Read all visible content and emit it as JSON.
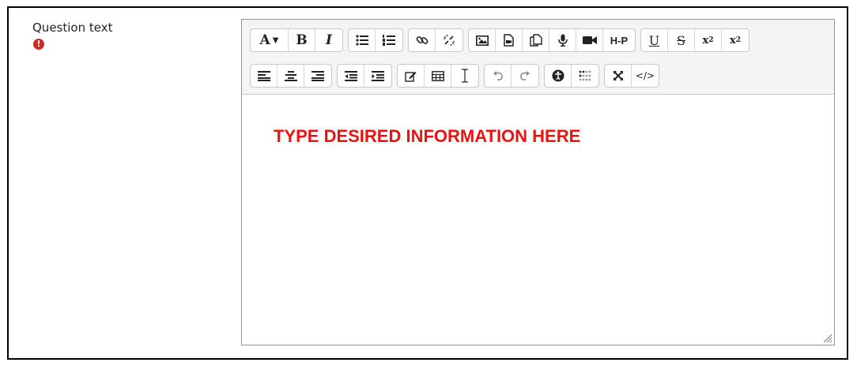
{
  "field": {
    "label": "Question text",
    "required_icon": "exclamation-circle-icon"
  },
  "toolbar": {
    "font_button": "A",
    "bold": "B",
    "italic": "I",
    "h5p": "H-P",
    "underline": "U",
    "strike": "S",
    "subscript_base": "x",
    "subscript_mark": "2",
    "superscript_base": "x",
    "superscript_mark": "2",
    "html": "</>"
  },
  "editor": {
    "content": "TYPE DESIRED INFORMATION HERE"
  },
  "colors": {
    "content_text": "#ee1111",
    "required": "#ca3120",
    "toolbar_bg": "#f4f4f4"
  }
}
